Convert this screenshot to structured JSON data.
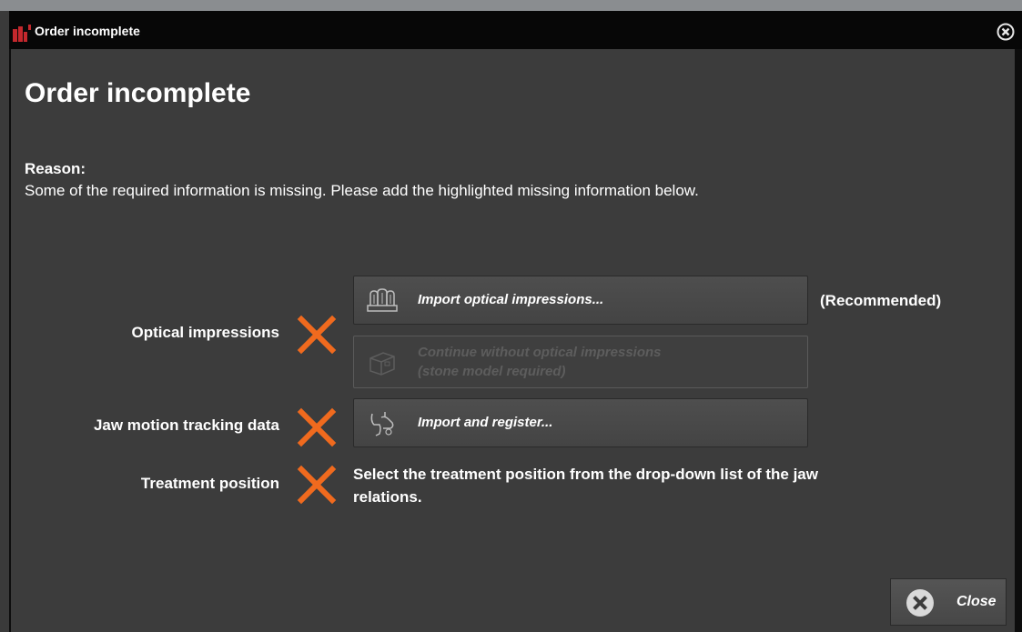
{
  "window": {
    "title": "Order incomplete"
  },
  "dialog": {
    "heading": "Order incomplete",
    "reason_label": "Reason:",
    "reason_text": "Some of the required information is missing. Please add the highlighted missing information below."
  },
  "rows": {
    "optical": {
      "label": "Optical impressions",
      "import_button": "Import optical impressions...",
      "recommended": "(Recommended)",
      "continue_button_line1": "Continue without optical impressions",
      "continue_button_line2": "(stone model required)"
    },
    "jaw": {
      "label": "Jaw motion tracking data",
      "import_button": "Import and register..."
    },
    "treatment": {
      "label": "Treatment position",
      "instruction": "Select the treatment position from the drop-down list of the jaw relations."
    }
  },
  "footer": {
    "close_label": "Close"
  },
  "colors": {
    "accent_x": "#f06a1e",
    "panel_bg": "#3c3c3c",
    "titlebar_bg": "#070707",
    "logo_red": "#c4282d"
  },
  "icons": {
    "app": "app-logo-icon",
    "title_close": "close-circle-icon",
    "optical_import": "teeth-scan-icon",
    "continue_without": "box-model-icon",
    "jaw_import": "jaw-tracker-icon",
    "missing": "x-mark-icon",
    "close": "close-circle-icon"
  }
}
